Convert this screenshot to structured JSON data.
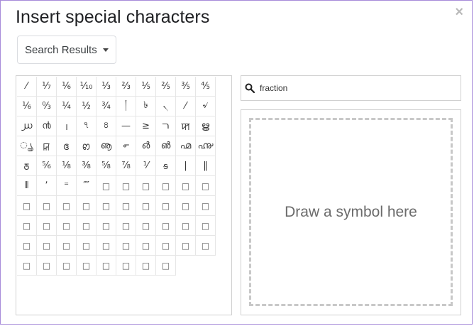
{
  "dialog": {
    "title": "Insert special characters",
    "close_glyph": "×"
  },
  "category_dropdown": {
    "selected": "Search Results"
  },
  "search": {
    "value": "fraction"
  },
  "draw_area": {
    "label": "Draw a symbol here"
  },
  "characters": [
    "⁄",
    "⅐",
    "⅙",
    "⅒",
    "⅓",
    "⅔",
    "⅕",
    "⅖",
    "⅗",
    "⅘",
    "⅙",
    "↉",
    "¼",
    "½",
    "¾",
    "།",
    "৳",
    "৲",
    "⁄",
    "৵",
    "൰",
    "൯",
    "।",
    "৭",
    "৪",
    "—",
    "≥",
    "ﬧ",
    "ꠇ",
    "ൠ",
    "ൄ",
    "ꡒ",
    "ꢏ",
    "ꢙ",
    "ൡ",
    "൳",
    "൴",
    "൵",
    "൶",
    "൷",
    "ꢜ",
    "⅚",
    "⅛",
    "⅜",
    "⅝",
    "⅞",
    "⅟",
    "ᵴ",
    "|",
    "‖",
    "⫴",
    "ʼ",
    "⁼",
    "⁗",
    "□",
    "□",
    "□",
    "□",
    "□",
    "□",
    "□",
    "□",
    "□",
    "□",
    "□",
    "□",
    "□",
    "□",
    "□",
    "□",
    "□",
    "□",
    "□",
    "□",
    "□",
    "□",
    "□",
    "□",
    "□",
    "□",
    "□",
    "□",
    "□",
    "□",
    "□",
    "□",
    "□",
    "□",
    "□",
    "□",
    "□",
    "□",
    "□",
    "□",
    "□",
    "□",
    "□",
    "□"
  ]
}
